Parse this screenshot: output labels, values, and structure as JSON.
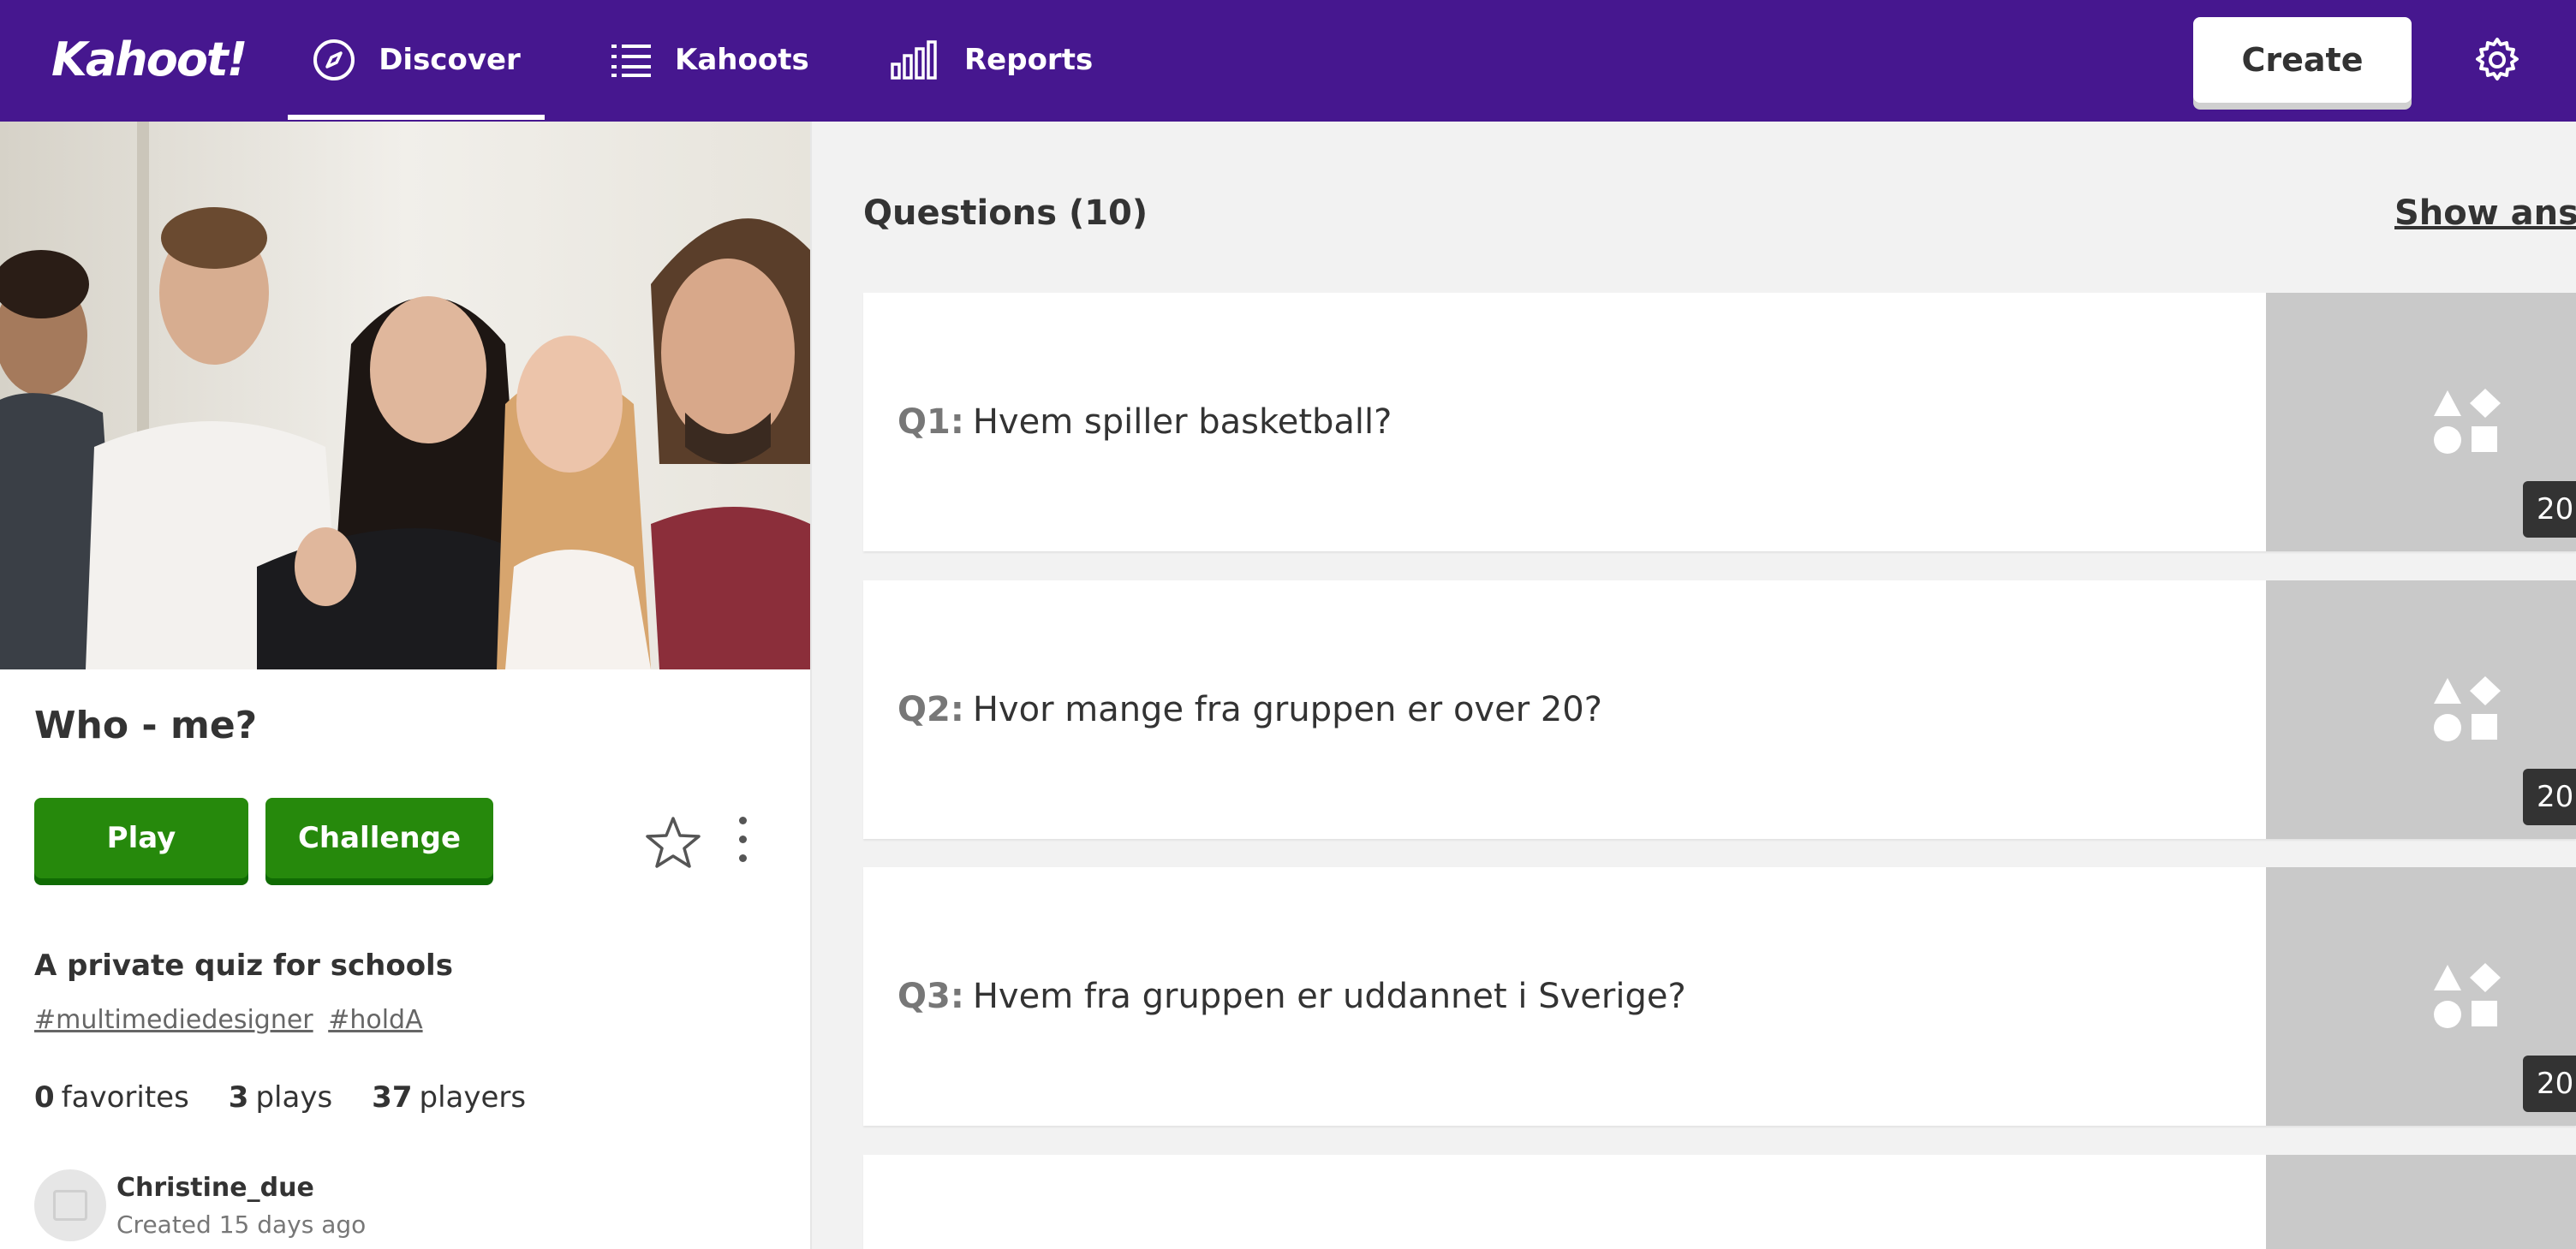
{
  "brand": {
    "logo_text": "Kahoot!",
    "primary_color": "#46178f",
    "play_green": "#26890c"
  },
  "nav": {
    "items": [
      {
        "label": "Discover",
        "icon": "compass-icon",
        "active": true
      },
      {
        "label": "Kahoots",
        "icon": "list-icon",
        "active": false
      },
      {
        "label": "Reports",
        "icon": "bar-chart-icon",
        "active": false
      }
    ],
    "create_label": "Create",
    "settings_icon": "gear-icon"
  },
  "kahoot": {
    "title": "Who - me?",
    "play_label": "Play",
    "challenge_label": "Challenge",
    "visibility_text": "A private quiz for schools",
    "tags": [
      "#multimediedesigner",
      "#holdA"
    ],
    "stats": {
      "favorites_count": "0",
      "favorites_label": "favorites",
      "plays_count": "3",
      "plays_label": "plays",
      "players_count": "37",
      "players_label": "players"
    },
    "author": "Christine_due",
    "created": "Created 15 days ago"
  },
  "questions": {
    "header": "Questions (10)",
    "show_answers_label": "Show answers",
    "items": [
      {
        "number": "Q1:",
        "text": "Hvem spiller basketball?",
        "time": "20"
      },
      {
        "number": "Q2:",
        "text": "Hvor mange fra gruppen er over 20?",
        "time": "20"
      },
      {
        "number": "Q3:",
        "text": "Hvem fra gruppen er uddannet i Sverige?",
        "time": "20"
      },
      {
        "number": "",
        "text": "",
        "time": ""
      }
    ]
  }
}
